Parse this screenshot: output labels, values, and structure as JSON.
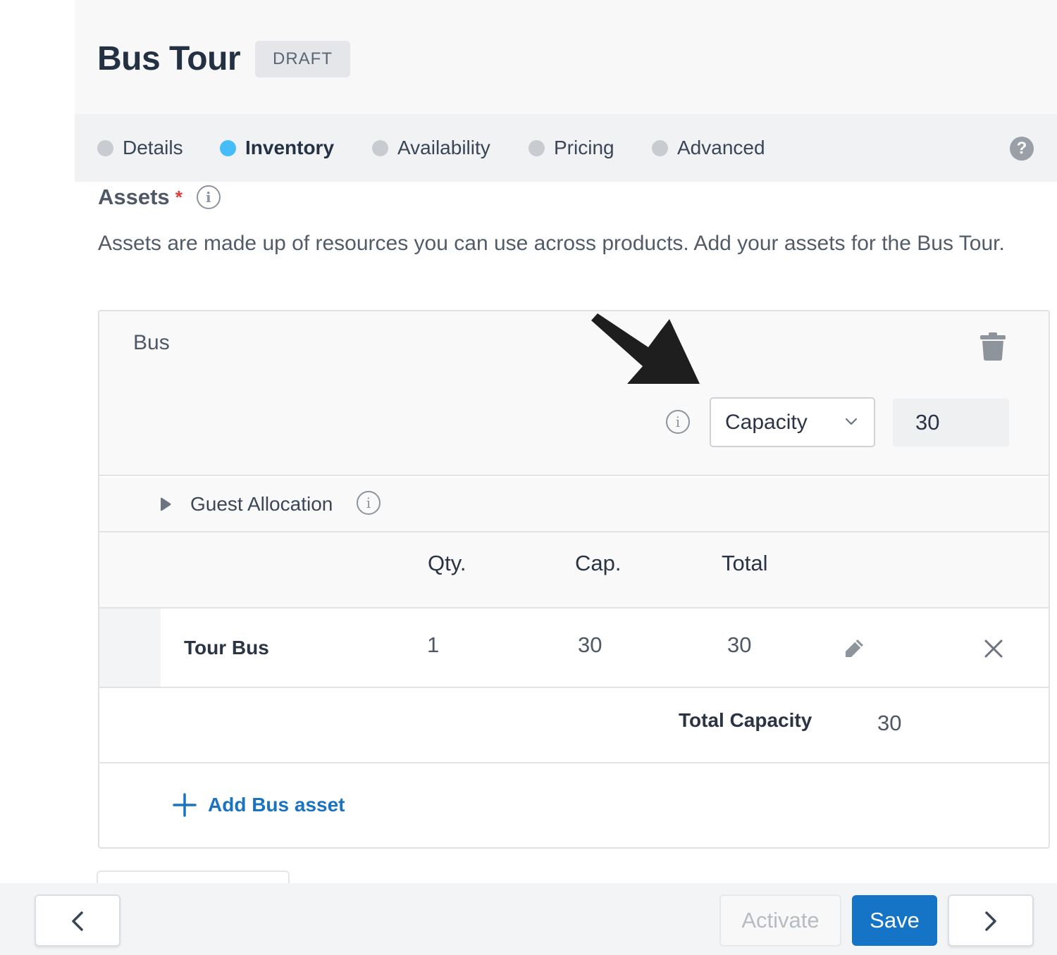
{
  "header": {
    "title": "Bus Tour",
    "status": "DRAFT"
  },
  "tabs": [
    {
      "label": "Details",
      "active": false
    },
    {
      "label": "Inventory",
      "active": true
    },
    {
      "label": "Availability",
      "active": false
    },
    {
      "label": "Pricing",
      "active": false
    },
    {
      "label": "Advanced",
      "active": false
    }
  ],
  "help_label": "?",
  "assets": {
    "title": "Assets",
    "required_marker": "*",
    "description": "Assets are made up of resources you can use across products. Add your assets for the Bus Tour."
  },
  "asset_card": {
    "name": "Bus",
    "mode_select": {
      "value": "Capacity"
    },
    "mode_value": "30",
    "guest_allocation_label": "Guest Allocation",
    "columns": [
      "Qty.",
      "Cap.",
      "Total"
    ],
    "rows": [
      {
        "name": "Tour Bus",
        "qty": "1",
        "cap": "30",
        "total": "30"
      }
    ],
    "total_label": "Total Capacity",
    "total_value": "30",
    "add_label": "Add Bus asset"
  },
  "footer": {
    "activate_label": "Activate",
    "save_label": "Save"
  },
  "colors": {
    "accent": "#1674c6",
    "active_tab_dot": "#45bdfa",
    "inactive_tab_dot": "#c8cbd0",
    "required": "#e23b3b"
  },
  "icons": {
    "help": "question-circle-icon",
    "info": "info-icon",
    "delete": "trash-icon",
    "dropdown": "chevron-down-icon",
    "expand": "caret-right-icon",
    "edit": "pencil-icon",
    "remove": "close-icon",
    "add": "plus-icon",
    "back": "chevron-left-icon",
    "next": "chevron-right-icon"
  }
}
